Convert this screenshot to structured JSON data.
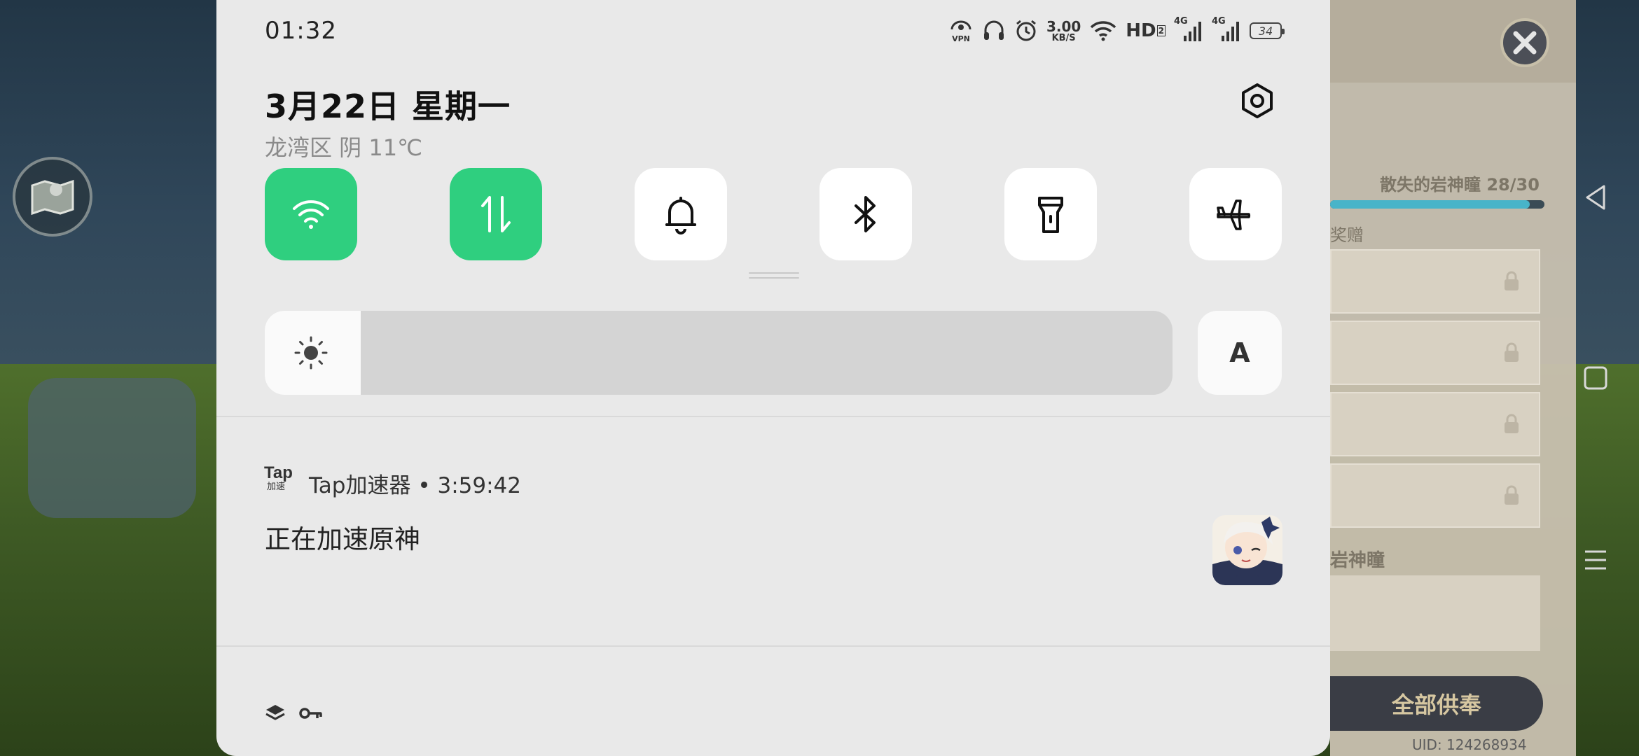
{
  "status_bar": {
    "time": "01:32",
    "vpn_label": "VPN",
    "speed_value": "3.00",
    "speed_unit": "KB/S",
    "hd_label": "HD",
    "hd_sub": "2",
    "sim1_type": "4G",
    "sim2_type": "4G",
    "battery_level": "34"
  },
  "header": {
    "date": "3月22日  星期一",
    "weather": "龙湾区 阴 11℃"
  },
  "quick_toggles": [
    {
      "name": "wifi",
      "icon": "wifi-icon",
      "on": true
    },
    {
      "name": "mobile-data",
      "icon": "mobile-data-icon",
      "on": true
    },
    {
      "name": "ring",
      "icon": "bell-icon",
      "on": false
    },
    {
      "name": "bluetooth",
      "icon": "bluetooth-icon",
      "on": false
    },
    {
      "name": "flashlight",
      "icon": "flashlight-icon",
      "on": false
    },
    {
      "name": "airplane",
      "icon": "airplane-icon",
      "on": false
    }
  ],
  "brightness": {
    "level": 0.106,
    "auto_label": "A"
  },
  "notification": {
    "app_icon_line1": "Tap",
    "app_icon_line2": "加速",
    "header": "Tap加速器 • 3:59:42",
    "body": "正在加速原神"
  },
  "game_background": {
    "quest_title": "散失的岩神瞳 28/30",
    "progress": 0.933,
    "section_label": "奖赠",
    "section_label_2": "岩神瞳",
    "offer_all_button": "全部供奉",
    "uid": "UID: 124268934"
  },
  "colors": {
    "accent_green": "#2fcf7f",
    "shade_bg": "#e9e9e9"
  }
}
